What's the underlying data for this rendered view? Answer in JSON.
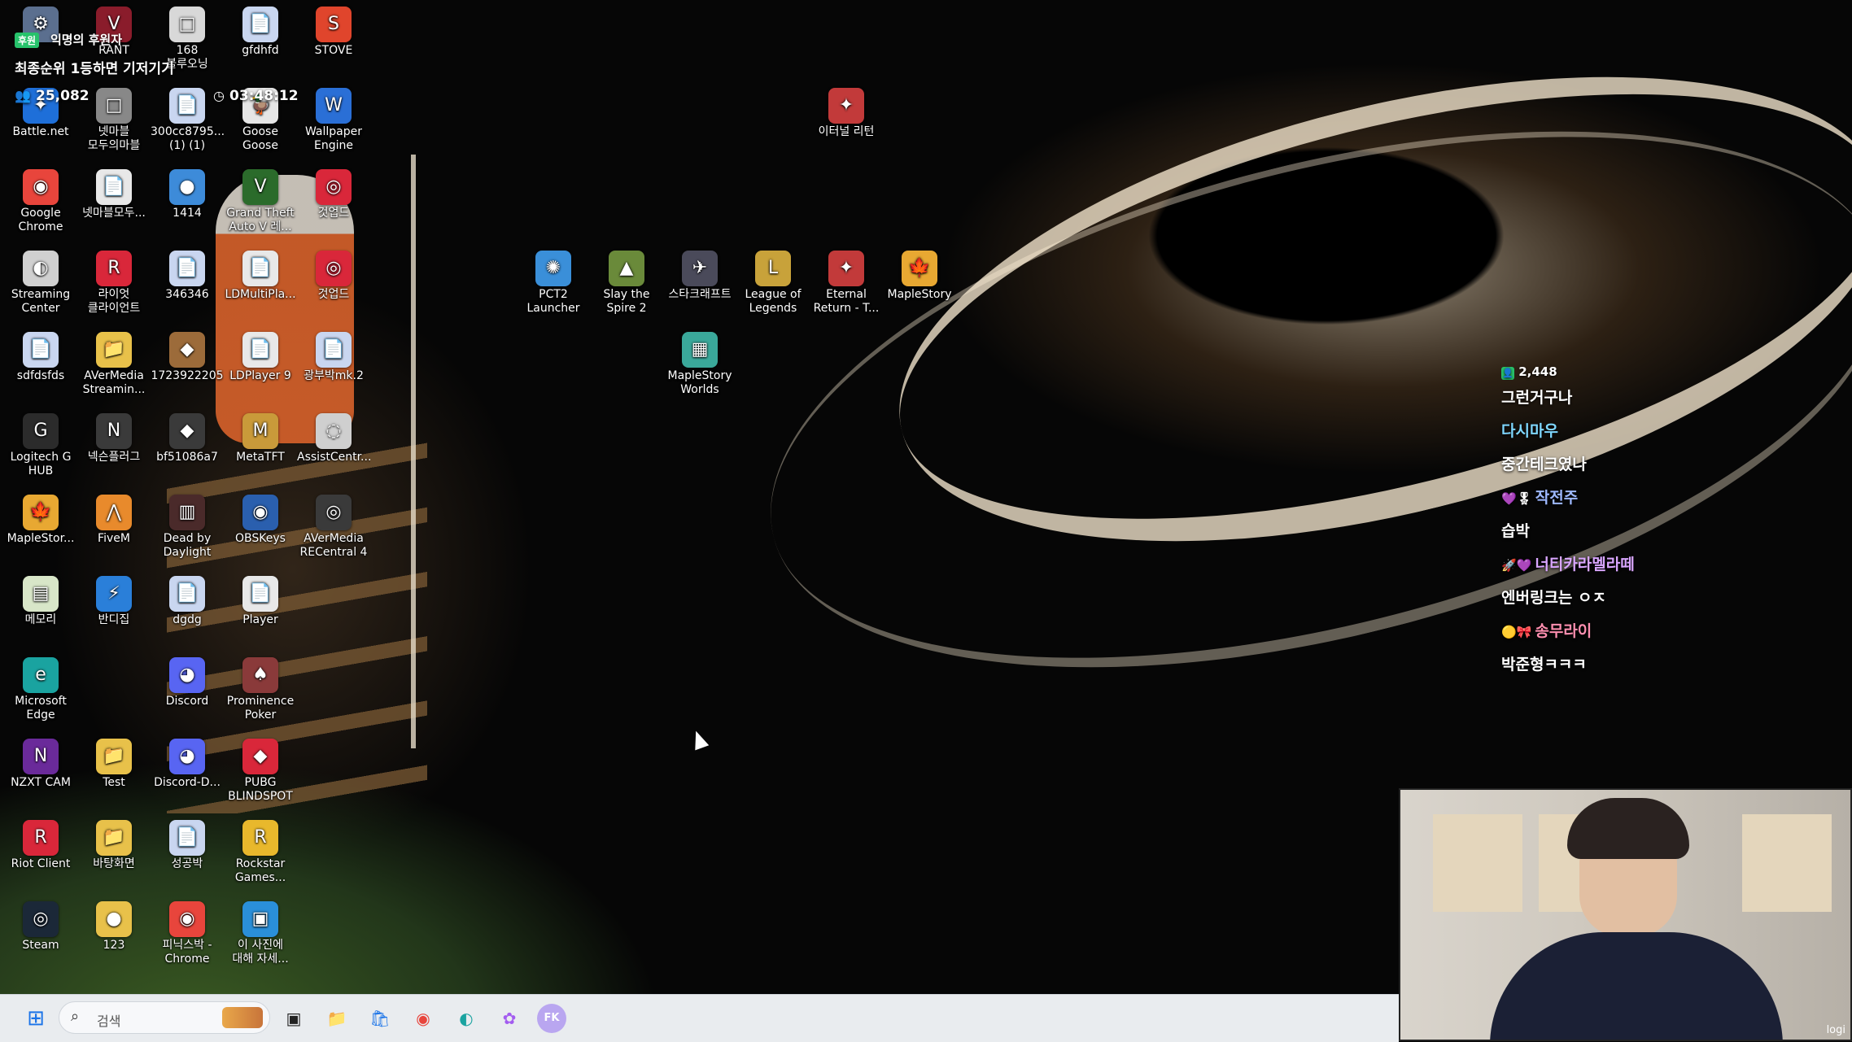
{
  "overlay": {
    "badge": "후원",
    "title": "익명의 후원자",
    "subtitle": "최종순위 1등하면 기저기기",
    "viewers": "25,082",
    "timer": "03:48:12"
  },
  "desktop_icons": [
    {
      "name": "",
      "col": 0,
      "row": 0,
      "color": "#5b6f8f",
      "glyph": "⚙"
    },
    {
      "name": "RANT",
      "col": 1,
      "row": 0,
      "color": "#8a1c2b",
      "glyph": "V"
    },
    {
      "name": "168\n블루오닝",
      "col": 2,
      "row": 0,
      "color": "#d8d8d8",
      "glyph": "□"
    },
    {
      "name": "gfdhfd",
      "col": 3,
      "row": 0,
      "color": "#c9d6f0",
      "glyph": "📄"
    },
    {
      "name": "STOVE",
      "col": 4,
      "row": 0,
      "color": "#e0452c",
      "glyph": "S"
    },
    {
      "name": "Battle.net",
      "col": 0,
      "row": 1,
      "color": "#1e6fd9",
      "glyph": "✦"
    },
    {
      "name": "넷마블\n모두의마블",
      "col": 1,
      "row": 1,
      "color": "#888888",
      "glyph": "□"
    },
    {
      "name": "300cc8795...\n(1) (1)",
      "col": 2,
      "row": 1,
      "color": "#c9d6f0",
      "glyph": "📄"
    },
    {
      "name": "Goose Goose\nDuck",
      "col": 3,
      "row": 1,
      "color": "#e6e6e6",
      "glyph": "🦆"
    },
    {
      "name": "Wallpaper\nEngine",
      "col": 4,
      "row": 1,
      "color": "#2a6fd6",
      "glyph": "W"
    },
    {
      "name": "Google\nChrome",
      "col": 0,
      "row": 2,
      "color": "#e8453c",
      "glyph": "◉"
    },
    {
      "name": "넷마블모두...",
      "col": 1,
      "row": 2,
      "color": "#e8e8e8",
      "glyph": "📄"
    },
    {
      "name": "1414",
      "col": 2,
      "row": 2,
      "color": "#3d8bd9",
      "glyph": "●"
    },
    {
      "name": "Grand Theft\nAuto V 레...",
      "col": 3,
      "row": 2,
      "color": "#2b6b2b",
      "glyph": "V"
    },
    {
      "name": "것업드",
      "col": 4,
      "row": 2,
      "color": "#d9273a",
      "glyph": "◎"
    },
    {
      "name": "Streaming\nCenter",
      "col": 0,
      "row": 3,
      "color": "#d0d0d0",
      "glyph": "◐"
    },
    {
      "name": "라이엇\n클라이언트",
      "col": 1,
      "row": 3,
      "color": "#d9273a",
      "glyph": "R"
    },
    {
      "name": "346346",
      "col": 2,
      "row": 3,
      "color": "#c9d6f0",
      "glyph": "📄"
    },
    {
      "name": "LDMultiPla...",
      "col": 3,
      "row": 3,
      "color": "#e8e8e8",
      "glyph": "📄"
    },
    {
      "name": "것업드",
      "col": 4,
      "row": 3,
      "color": "#d9273a",
      "glyph": "◎"
    },
    {
      "name": "sdfdsfds",
      "col": 0,
      "row": 4,
      "color": "#c9d6f0",
      "glyph": "📄"
    },
    {
      "name": "AVerMedia\nStreamin...",
      "col": 1,
      "row": 4,
      "color": "#e8c14a",
      "glyph": "📁"
    },
    {
      "name": "1723922205",
      "col": 2,
      "row": 4,
      "color": "#9c6b3a",
      "glyph": "◆"
    },
    {
      "name": "LDPlayer 9",
      "col": 3,
      "row": 4,
      "color": "#e8e8e8",
      "glyph": "📄"
    },
    {
      "name": "광부박mk.2",
      "col": 4,
      "row": 4,
      "color": "#c9d6f0",
      "glyph": "📄"
    },
    {
      "name": "Logitech G\nHUB",
      "col": 0,
      "row": 5,
      "color": "#2b2b2b",
      "glyph": "G"
    },
    {
      "name": "넥슨플러그",
      "col": 1,
      "row": 5,
      "color": "#3a3a3a",
      "glyph": "N"
    },
    {
      "name": "bf51086a7",
      "col": 2,
      "row": 5,
      "color": "#3a3a3a",
      "glyph": "◆"
    },
    {
      "name": "MetaTFT",
      "col": 3,
      "row": 5,
      "color": "#c99a3a",
      "glyph": "M"
    },
    {
      "name": "AssistCentr...",
      "col": 4,
      "row": 5,
      "color": "#cfcfcf",
      "glyph": "◌"
    },
    {
      "name": "MapleStor...",
      "col": 0,
      "row": 6,
      "color": "#e8a832",
      "glyph": "🍁"
    },
    {
      "name": "FiveM",
      "col": 1,
      "row": 6,
      "color": "#e88a2c",
      "glyph": "⋀"
    },
    {
      "name": "Dead by\nDaylight",
      "col": 2,
      "row": 6,
      "color": "#4a2a2a",
      "glyph": "▥"
    },
    {
      "name": "OBSKeys",
      "col": 3,
      "row": 6,
      "color": "#2a5fae",
      "glyph": "◉"
    },
    {
      "name": "AVerMedia\nRECentral 4",
      "col": 4,
      "row": 6,
      "color": "#3a3a3a",
      "glyph": "◎"
    },
    {
      "name": "메모리",
      "col": 0,
      "row": 7,
      "color": "#d8e6c8",
      "glyph": "▤"
    },
    {
      "name": "반디집",
      "col": 1,
      "row": 7,
      "color": "#2a7fd9",
      "glyph": "⚡"
    },
    {
      "name": "dgdg",
      "col": 2,
      "row": 7,
      "color": "#c9d6f0",
      "glyph": "📄"
    },
    {
      "name": "Player",
      "col": 3,
      "row": 7,
      "color": "#e8e8e8",
      "glyph": "📄"
    },
    {
      "name": "Microsoft\nEdge",
      "col": 0,
      "row": 8,
      "color": "#1aa3a0",
      "glyph": "e"
    },
    {
      "name": "Discord",
      "col": 2,
      "row": 8,
      "color": "#5865f2",
      "glyph": "◕"
    },
    {
      "name": "Prominence\nPoker",
      "col": 3,
      "row": 8,
      "color": "#8a3a3a",
      "glyph": "♠"
    },
    {
      "name": "NZXT CAM",
      "col": 0,
      "row": 9,
      "color": "#6a2a9a",
      "glyph": "N"
    },
    {
      "name": "Test",
      "col": 1,
      "row": 9,
      "color": "#e8c14a",
      "glyph": "📁"
    },
    {
      "name": "Discord-D...",
      "col": 2,
      "row": 9,
      "color": "#5865f2",
      "glyph": "◕"
    },
    {
      "name": "PUBG\nBLINDSPOT",
      "col": 3,
      "row": 9,
      "color": "#d9273a",
      "glyph": "◆"
    },
    {
      "name": "Riot Client",
      "col": 0,
      "row": 10,
      "color": "#d9273a",
      "glyph": "R"
    },
    {
      "name": "바탕화면",
      "col": 1,
      "row": 10,
      "color": "#e8c14a",
      "glyph": "📁"
    },
    {
      "name": "성공박",
      "col": 2,
      "row": 10,
      "color": "#c9d6f0",
      "glyph": "📄"
    },
    {
      "name": "Rockstar\nGames...",
      "col": 3,
      "row": 10,
      "color": "#e8b82c",
      "glyph": "R"
    },
    {
      "name": "Steam",
      "col": 0,
      "row": 11,
      "color": "#1b2838",
      "glyph": "◎"
    },
    {
      "name": "123",
      "col": 1,
      "row": 11,
      "color": "#e8c14a",
      "glyph": "●"
    },
    {
      "name": "피닉스박 -\nChrome",
      "col": 2,
      "row": 11,
      "color": "#e8453c",
      "glyph": "◉"
    },
    {
      "name": "이 사진에\n대해 자세...",
      "col": 3,
      "row": 11,
      "color": "#2a8fd9",
      "glyph": "▣"
    },
    {
      "name": "이터널 리턴",
      "col": 11,
      "row": 1,
      "color": "#c23a3a",
      "glyph": "✦"
    },
    {
      "name": "PCT2\nLauncher",
      "col": 7,
      "row": 3,
      "color": "#3a8fd9",
      "glyph": "✺"
    },
    {
      "name": "Slay the\nSpire 2",
      "col": 8,
      "row": 3,
      "color": "#6a8a3a",
      "glyph": "▲"
    },
    {
      "name": "스타크래프트",
      "col": 9,
      "row": 3,
      "color": "#4a4a5a",
      "glyph": "✈"
    },
    {
      "name": "League of\nLegends",
      "col": 10,
      "row": 3,
      "color": "#c8a23a",
      "glyph": "L"
    },
    {
      "name": "Eternal\nReturn - T...",
      "col": 11,
      "row": 3,
      "color": "#c23a3a",
      "glyph": "✦"
    },
    {
      "name": "MapleStory",
      "col": 12,
      "row": 3,
      "color": "#e8a832",
      "glyph": "🍁"
    },
    {
      "name": "MapleStory\nWorlds",
      "col": 9,
      "row": 4,
      "color": "#3aa89a",
      "glyph": "▦"
    }
  ],
  "chat": {
    "viewer_count": "2,448",
    "messages": [
      {
        "text": "그런거구나",
        "color": "#ffffff"
      },
      {
        "text": "다시마우",
        "color": "#7fd7ff"
      },
      {
        "text": "중간테크였나",
        "color": "#ffffff"
      },
      {
        "text": "작전주",
        "color": "#9db8ff",
        "badges": "💜🎖"
      },
      {
        "text": "습박",
        "color": "#ffffff"
      },
      {
        "text": "너티카라멜라떼",
        "color": "#d9a6ff",
        "badges": "🚀💜"
      },
      {
        "text": "엔버링크는 ㅇㅈ",
        "color": "#ffffff"
      },
      {
        "text": "송무라이",
        "color": "#ff8fb0",
        "badges": "🟡🎀"
      },
      {
        "text": "박준형ㅋㅋㅋ",
        "color": "#ffffff"
      }
    ]
  },
  "taskbar": {
    "search_placeholder": "검색",
    "apps": [
      "start",
      "search",
      "task-view",
      "file-explorer",
      "microsoft-store",
      "chrome",
      "edge",
      "copilot",
      "fk"
    ]
  },
  "webcam": {
    "corner_label": "logi"
  }
}
